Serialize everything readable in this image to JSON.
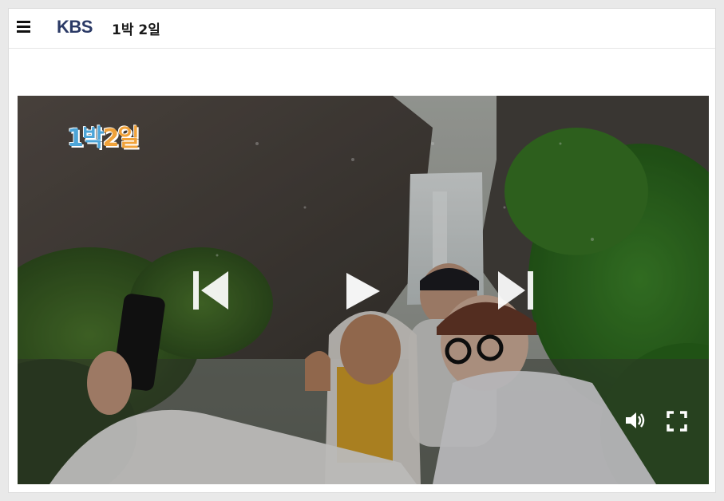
{
  "header": {
    "brand": "KBS",
    "program_title": "1박 2일"
  },
  "video": {
    "overlay_logo_part1": "1박",
    "overlay_logo_part2": "2일"
  },
  "icons": {
    "menu": "hamburger-menu-icon",
    "prev": "skip-previous-icon",
    "play": "play-icon",
    "next": "skip-next-icon",
    "volume": "volume-icon",
    "fullscreen": "fullscreen-icon"
  },
  "colors": {
    "brand": "#2b3a66",
    "controls": "#ffffff",
    "logo_blue": "#4da5d8",
    "logo_orange": "#f0a23a"
  }
}
